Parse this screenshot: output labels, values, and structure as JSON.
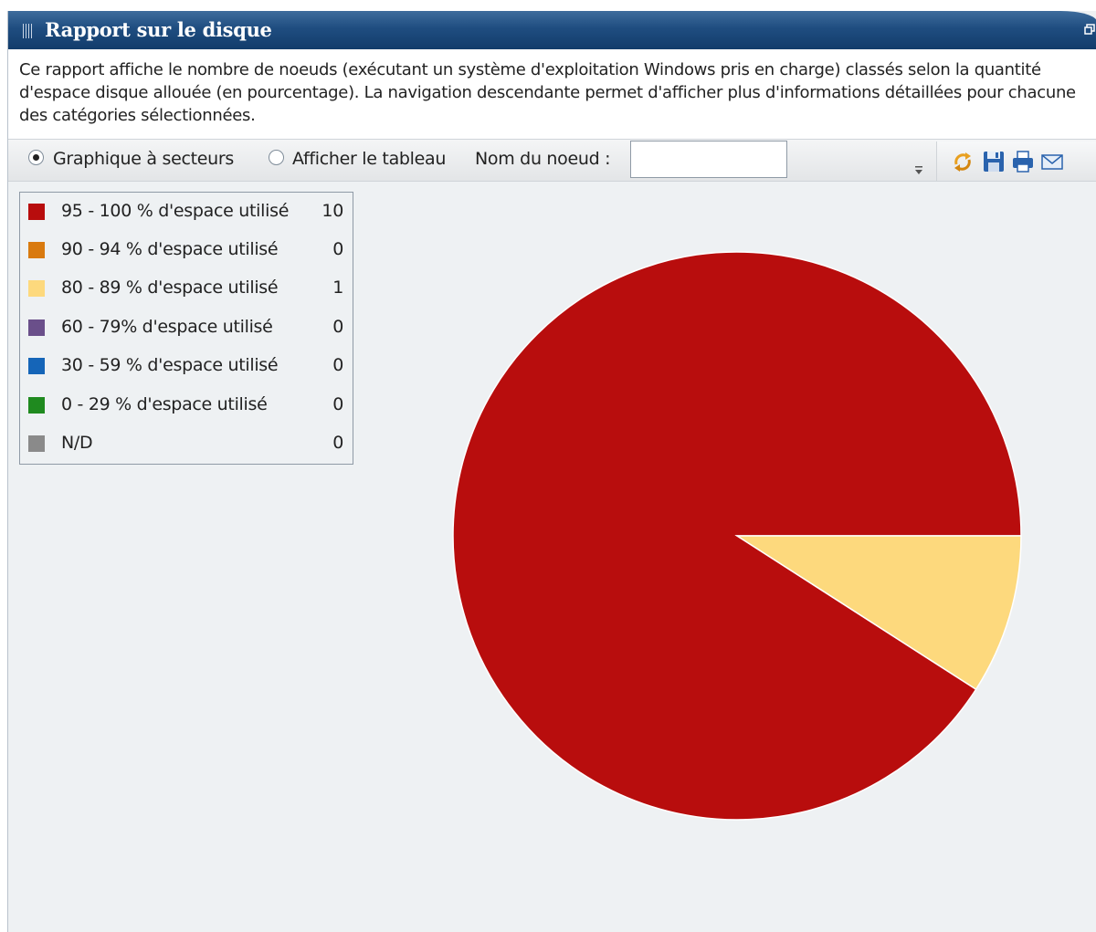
{
  "window": {
    "title": "Rapport sur le disque",
    "description": "Ce rapport affiche le nombre de noeuds (exécutant un système d'exploitation Windows pris en charge) classés selon la quantité d'espace disque allouée (en pourcentage). La navigation descendante permet d'afficher plus d'informations détaillées pour chacune des catégories sélectionnées."
  },
  "toolbar": {
    "view_options": [
      {
        "label": "Graphique à secteurs",
        "selected": true
      },
      {
        "label": "Afficher le tableau",
        "selected": false
      }
    ],
    "node_name_label": "Nom du noeud :",
    "node_name_value": "",
    "icons": [
      "dropdown-icon",
      "refresh-icon",
      "save-icon",
      "print-icon",
      "email-icon"
    ]
  },
  "colors": {
    "title_bar": "#1f4d80",
    "background": "#eef1f3"
  },
  "chart_data": {
    "type": "pie",
    "categories": [
      "95 - 100 % d'espace utilisé",
      "90 - 94 % d'espace utilisé",
      "80 - 89 % d'espace utilisé",
      "60 - 79% d'espace utilisé",
      "30 - 59 % d'espace utilisé",
      "0 - 29 % d'espace utilisé",
      "N/D"
    ],
    "values": [
      10,
      0,
      1,
      0,
      0,
      0,
      0
    ],
    "colors": [
      "#b80d0d",
      "#d97a0f",
      "#fdd97d",
      "#6a4f8a",
      "#1565b8",
      "#1f8a1f",
      "#8a8a8a"
    ],
    "legend_placement": "top-left",
    "start_angle_deg": 0,
    "direction": "counterclockwise"
  }
}
